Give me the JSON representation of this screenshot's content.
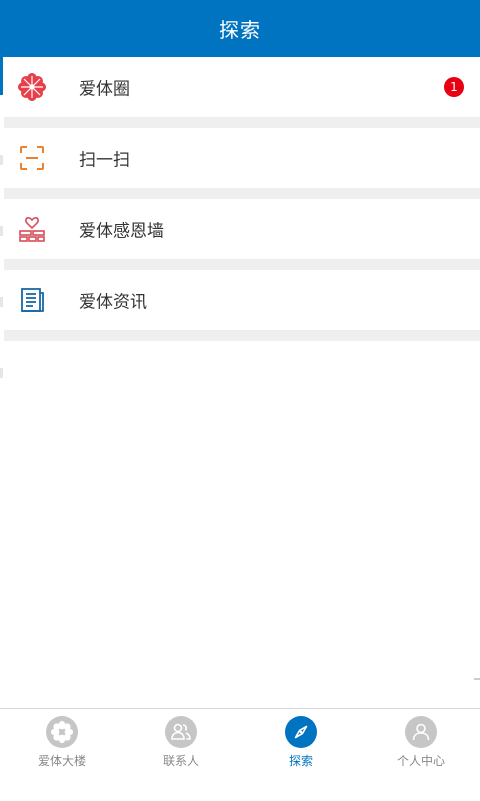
{
  "header": {
    "title": "探索"
  },
  "menu": {
    "items": [
      {
        "label": "爱体圈",
        "icon": "flower-icon",
        "badge": "1"
      },
      {
        "label": "扫一扫",
        "icon": "scan-icon"
      },
      {
        "label": "爱体感恩墙",
        "icon": "heart-wall-icon"
      },
      {
        "label": "爱体资讯",
        "icon": "news-icon"
      }
    ]
  },
  "tabbar": {
    "tabs": [
      {
        "label": "爱体大楼",
        "icon": "flower-icon",
        "active": false
      },
      {
        "label": "联系人",
        "icon": "contacts-icon",
        "active": false
      },
      {
        "label": "探索",
        "icon": "compass-icon",
        "active": true
      },
      {
        "label": "个人中心",
        "icon": "user-icon",
        "active": false
      }
    ]
  },
  "colors": {
    "brand": "#0074c1",
    "badge": "#e60012",
    "flower_icon": "#e8404a",
    "scan_icon": "#f07f29",
    "heart_wall_icon": "#d84d57",
    "news_icon": "#1768a7",
    "inactive_tab": "#c6c6c6"
  }
}
